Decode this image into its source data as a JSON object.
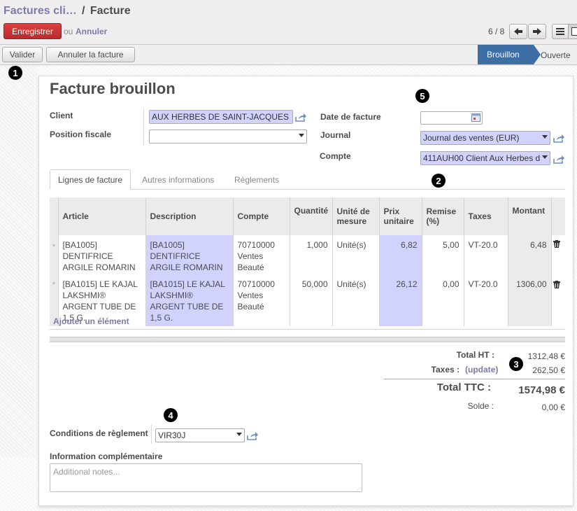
{
  "breadcrumb": {
    "parent": "Factures cli…",
    "separator": "/",
    "current": "Facture"
  },
  "toolbar": {
    "save_label": "Enregistrer",
    "or_label": "ou",
    "cancel_label": "Annuler"
  },
  "pager": {
    "text": "6 / 8"
  },
  "statusbar": {
    "validate_label": "Valider",
    "cancel_invoice_label": "Annuler la facture",
    "stages": [
      "Brouillon",
      "Ouverte"
    ],
    "active_stage": "Brouillon"
  },
  "markers": [
    "1",
    "2",
    "3",
    "4",
    "5"
  ],
  "form": {
    "title": "Facture brouillon",
    "client_label": "Client",
    "client_value": "AUX HERBES DE SAINT-JACQUES",
    "fiscal_position_label": "Position fiscale",
    "fiscal_position_value": "",
    "invoice_date_label": "Date de facture",
    "invoice_date_value": "",
    "journal_label": "Journal",
    "journal_value": "Journal des ventes (EUR)",
    "account_label": "Compte",
    "account_value": "411AUH00 Client Aux Herbes d"
  },
  "tabs": [
    {
      "label": "Lignes de facture"
    },
    {
      "label": "Autres informations"
    },
    {
      "label": "Règlements"
    }
  ],
  "table": {
    "headers": [
      "Article",
      "Description",
      "Compte",
      "Quantité",
      "Unité de mesure",
      "Prix unitaire",
      "Remise (%)",
      "Taxes",
      "Montant"
    ],
    "rows": [
      {
        "article": "[BA1005] DENTIFRICE ARGILE ROMARIN",
        "description": "[BA1005] DENTIFRICE ARGILE ROMARIN",
        "account": "70710000 Ventes Beauté",
        "quantity": "1,000",
        "uom": "Unité(s)",
        "unit_price": "6,82",
        "discount": "5,00",
        "taxes": "VT-20.0",
        "amount": "6,48"
      },
      {
        "article": "[BA1015] LE KAJAL LAKSHMI® ARGENT TUBE DE 1,5 G.",
        "description": "[BA1015] LE KAJAL LAKSHMI® ARGENT TUBE DE 1,5 G.",
        "account": "70710000 Ventes Beauté",
        "quantity": "50,000",
        "uom": "Unité(s)",
        "unit_price": "26,12",
        "discount": "0,00",
        "taxes": "VT-20.0",
        "amount": "1306,00"
      }
    ],
    "add_line_label": "Ajouter un élément"
  },
  "totals": {
    "untaxed_label": "Total HT :",
    "untaxed_value": "1312,48 €",
    "taxes_label": "Taxes :",
    "update_label": "(update)",
    "taxes_value": "262,50 €",
    "total_label": "Total TTC :",
    "total_value": "1574,98 €",
    "balance_label": "Solde :",
    "balance_value": "0,00 €"
  },
  "payment_terms": {
    "label": "Conditions de règlement",
    "value": "VIR30J"
  },
  "notes": {
    "label": "Information complémentaire",
    "placeholder": "Additional notes..."
  },
  "colors": {
    "primary_button": "#c9302c",
    "stage_active": "#3d6ea4",
    "required_field": "#d2d2ff",
    "link": "#7c7bad"
  }
}
